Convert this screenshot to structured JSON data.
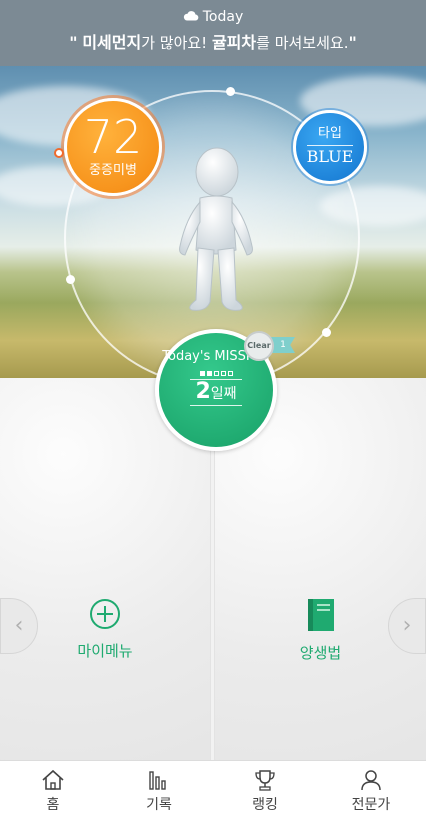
{
  "weather": {
    "label": "Today",
    "icon": "cloud-icon"
  },
  "banner": {
    "quote_open": "\"",
    "highlight1": "미세먼지",
    "text1": "가 많아요! ",
    "highlight2": "귤피차",
    "text2": "를 마셔보세요.",
    "quote_close": "\""
  },
  "score": {
    "value": "72",
    "label": "중증미병",
    "color": "#f7941d"
  },
  "type": {
    "label": "타입",
    "value": "BLUE",
    "color": "#1b7fd6"
  },
  "mission": {
    "title": "Today's MISSION",
    "progress": {
      "done": 2,
      "total": 5
    },
    "day_number": "2",
    "day_suffix": "일째",
    "clear_label": "Clear",
    "clear_count": "1",
    "color": "#1faa70"
  },
  "panels": {
    "left": {
      "label": "마이메뉴",
      "icon": "plus-circle-icon"
    },
    "right": {
      "label": "양생법",
      "icon": "book-icon"
    }
  },
  "arrows": {
    "left": "‹",
    "right": "›"
  },
  "nav": [
    {
      "label": "홈",
      "icon": "home-icon"
    },
    {
      "label": "기록",
      "icon": "chart-bars-icon"
    },
    {
      "label": "랭킹",
      "icon": "trophy-icon"
    },
    {
      "label": "전문가",
      "icon": "person-icon"
    }
  ]
}
